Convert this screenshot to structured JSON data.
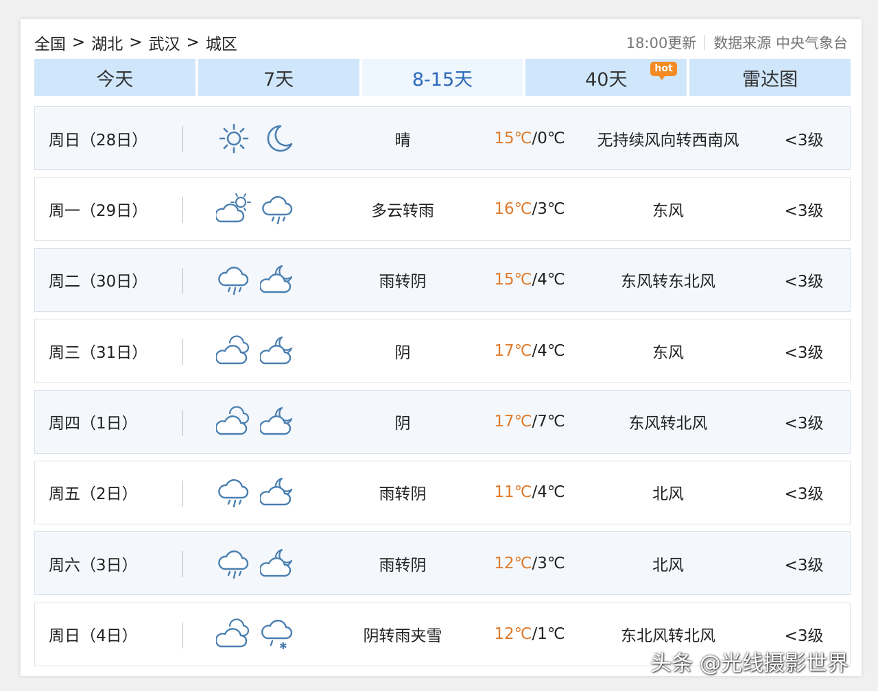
{
  "breadcrumb": [
    "全国",
    "湖北",
    "武汉",
    "城区"
  ],
  "breadcrumb_sep": ">",
  "update_time": "18:00更新",
  "source": "数据来源 中央气象台",
  "tabs": [
    {
      "label": "今天"
    },
    {
      "label": "7天"
    },
    {
      "label": "8-15天"
    },
    {
      "label": "40天",
      "badge": "hot"
    },
    {
      "label": "雷达图"
    }
  ],
  "active_tab": "8-15天",
  "colors": {
    "tab_bg": "#cfe6fb",
    "active_tab_text": "#2a68b8",
    "high_temp": "#e07a2a",
    "hot_badge": "#f48a24",
    "icon_stroke": "#4a7fb0"
  },
  "forecast": [
    {
      "date": "周日（28日）",
      "day_icon": "sun-icon",
      "night_icon": "moon-icon",
      "condition": "晴",
      "high": "15℃",
      "low": "0℃",
      "wind": "无持续风向转西南风",
      "level": "<3级"
    },
    {
      "date": "周一（29日）",
      "day_icon": "partly-cloudy-icon",
      "night_icon": "rain-icon",
      "condition": "多云转雨",
      "high": "16℃",
      "low": "3℃",
      "wind": "东风",
      "level": "<3级"
    },
    {
      "date": "周二（30日）",
      "day_icon": "rain-icon",
      "night_icon": "cloudy-night-icon",
      "condition": "雨转阴",
      "high": "15℃",
      "low": "4℃",
      "wind": "东风转东北风",
      "level": "<3级"
    },
    {
      "date": "周三（31日）",
      "day_icon": "overcast-icon",
      "night_icon": "cloudy-night-icon",
      "condition": "阴",
      "high": "17℃",
      "low": "4℃",
      "wind": "东风",
      "level": "<3级"
    },
    {
      "date": "周四（1日）",
      "day_icon": "overcast-icon",
      "night_icon": "cloudy-night-icon",
      "condition": "阴",
      "high": "17℃",
      "low": "7℃",
      "wind": "东风转北风",
      "level": "<3级"
    },
    {
      "date": "周五（2日）",
      "day_icon": "rain-icon",
      "night_icon": "cloudy-night-icon",
      "condition": "雨转阴",
      "high": "11℃",
      "low": "4℃",
      "wind": "北风",
      "level": "<3级"
    },
    {
      "date": "周六（3日）",
      "day_icon": "rain-icon",
      "night_icon": "cloudy-night-icon",
      "condition": "雨转阴",
      "high": "12℃",
      "low": "3℃",
      "wind": "北风",
      "level": "<3级"
    },
    {
      "date": "周日（4日）",
      "day_icon": "overcast-icon",
      "night_icon": "sleet-icon",
      "condition": "阴转雨夹雪",
      "high": "12℃",
      "low": "1℃",
      "wind": "东北风转北风",
      "level": "<3级"
    }
  ],
  "watermark": "头条 @光线摄影世界"
}
